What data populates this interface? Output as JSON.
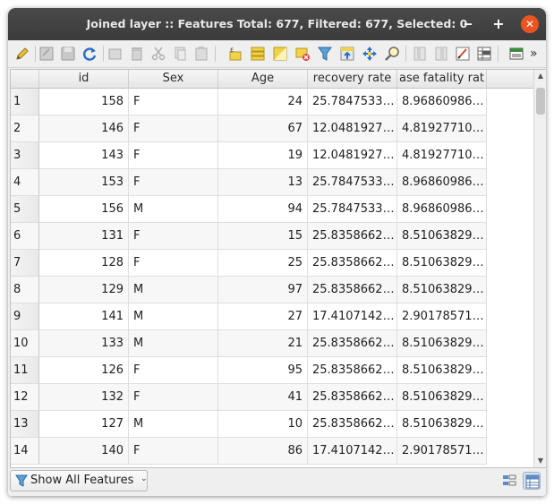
{
  "window": {
    "title": "Joined layer :: Features Total: 677, Filtered: 677, Selected: 0",
    "minimize_glyph": "‒",
    "maximize_glyph": "+",
    "close_glyph": "✕"
  },
  "toolbar": {
    "icons": [
      "pencil-icon",
      "save-edits-icon",
      "save-icon",
      "reload-icon",
      "add-feature-icon",
      "delete-feature-icon",
      "cut-icon",
      "copy-icon",
      "paste-icon",
      "expression-select-icon",
      "select-all-icon",
      "invert-selection-icon",
      "deselect-icon",
      "filter-icon",
      "move-selection-top-icon",
      "pan-to-selection-icon",
      "zoom-to-selection-icon",
      "new-field-icon",
      "delete-field-icon",
      "field-calculator-icon",
      "conditional-formatting-icon",
      "dock-icon",
      "more-icon"
    ],
    "overflow_glyph": "»"
  },
  "table": {
    "columns": [
      "id",
      "Sex",
      "Age",
      "recovery rate",
      "ase fatality rat"
    ],
    "rows": [
      {
        "n": "1",
        "id": "158",
        "sex": "F",
        "age": "24",
        "recovery": "25.7847533…",
        "fatality": "8.96860986…"
      },
      {
        "n": "2",
        "id": "146",
        "sex": "F",
        "age": "67",
        "recovery": "12.0481927…",
        "fatality": "4.81927710…"
      },
      {
        "n": "3",
        "id": "143",
        "sex": "F",
        "age": "19",
        "recovery": "12.0481927…",
        "fatality": "4.81927710…"
      },
      {
        "n": "4",
        "id": "153",
        "sex": "F",
        "age": "13",
        "recovery": "25.7847533…",
        "fatality": "8.96860986…"
      },
      {
        "n": "5",
        "id": "156",
        "sex": "M",
        "age": "94",
        "recovery": "25.7847533…",
        "fatality": "8.96860986…"
      },
      {
        "n": "6",
        "id": "131",
        "sex": "F",
        "age": "15",
        "recovery": "25.8358662…",
        "fatality": "8.51063829…"
      },
      {
        "n": "7",
        "id": "128",
        "sex": "F",
        "age": "25",
        "recovery": "25.8358662…",
        "fatality": "8.51063829…"
      },
      {
        "n": "8",
        "id": "129",
        "sex": "M",
        "age": "97",
        "recovery": "25.8358662…",
        "fatality": "8.51063829…"
      },
      {
        "n": "9",
        "id": "141",
        "sex": "M",
        "age": "27",
        "recovery": "17.4107142…",
        "fatality": "2.90178571…"
      },
      {
        "n": "10",
        "id": "133",
        "sex": "M",
        "age": "21",
        "recovery": "25.8358662…",
        "fatality": "8.51063829…"
      },
      {
        "n": "11",
        "id": "126",
        "sex": "F",
        "age": "95",
        "recovery": "25.8358662…",
        "fatality": "8.51063829…"
      },
      {
        "n": "12",
        "id": "132",
        "sex": "F",
        "age": "41",
        "recovery": "25.8358662…",
        "fatality": "8.51063829…"
      },
      {
        "n": "13",
        "id": "127",
        "sex": "M",
        "age": "10",
        "recovery": "25.8358662…",
        "fatality": "8.51063829…"
      },
      {
        "n": "14",
        "id": "140",
        "sex": "F",
        "age": "86",
        "recovery": "17.4107142…",
        "fatality": "2.90178571…"
      }
    ]
  },
  "bottom": {
    "filter_label": "Show All Features",
    "filter_arrow": "⌄"
  },
  "colors": {
    "titlebar": "#3b3b3b",
    "close_button": "#e95420",
    "window_bg": "#efefef"
  }
}
